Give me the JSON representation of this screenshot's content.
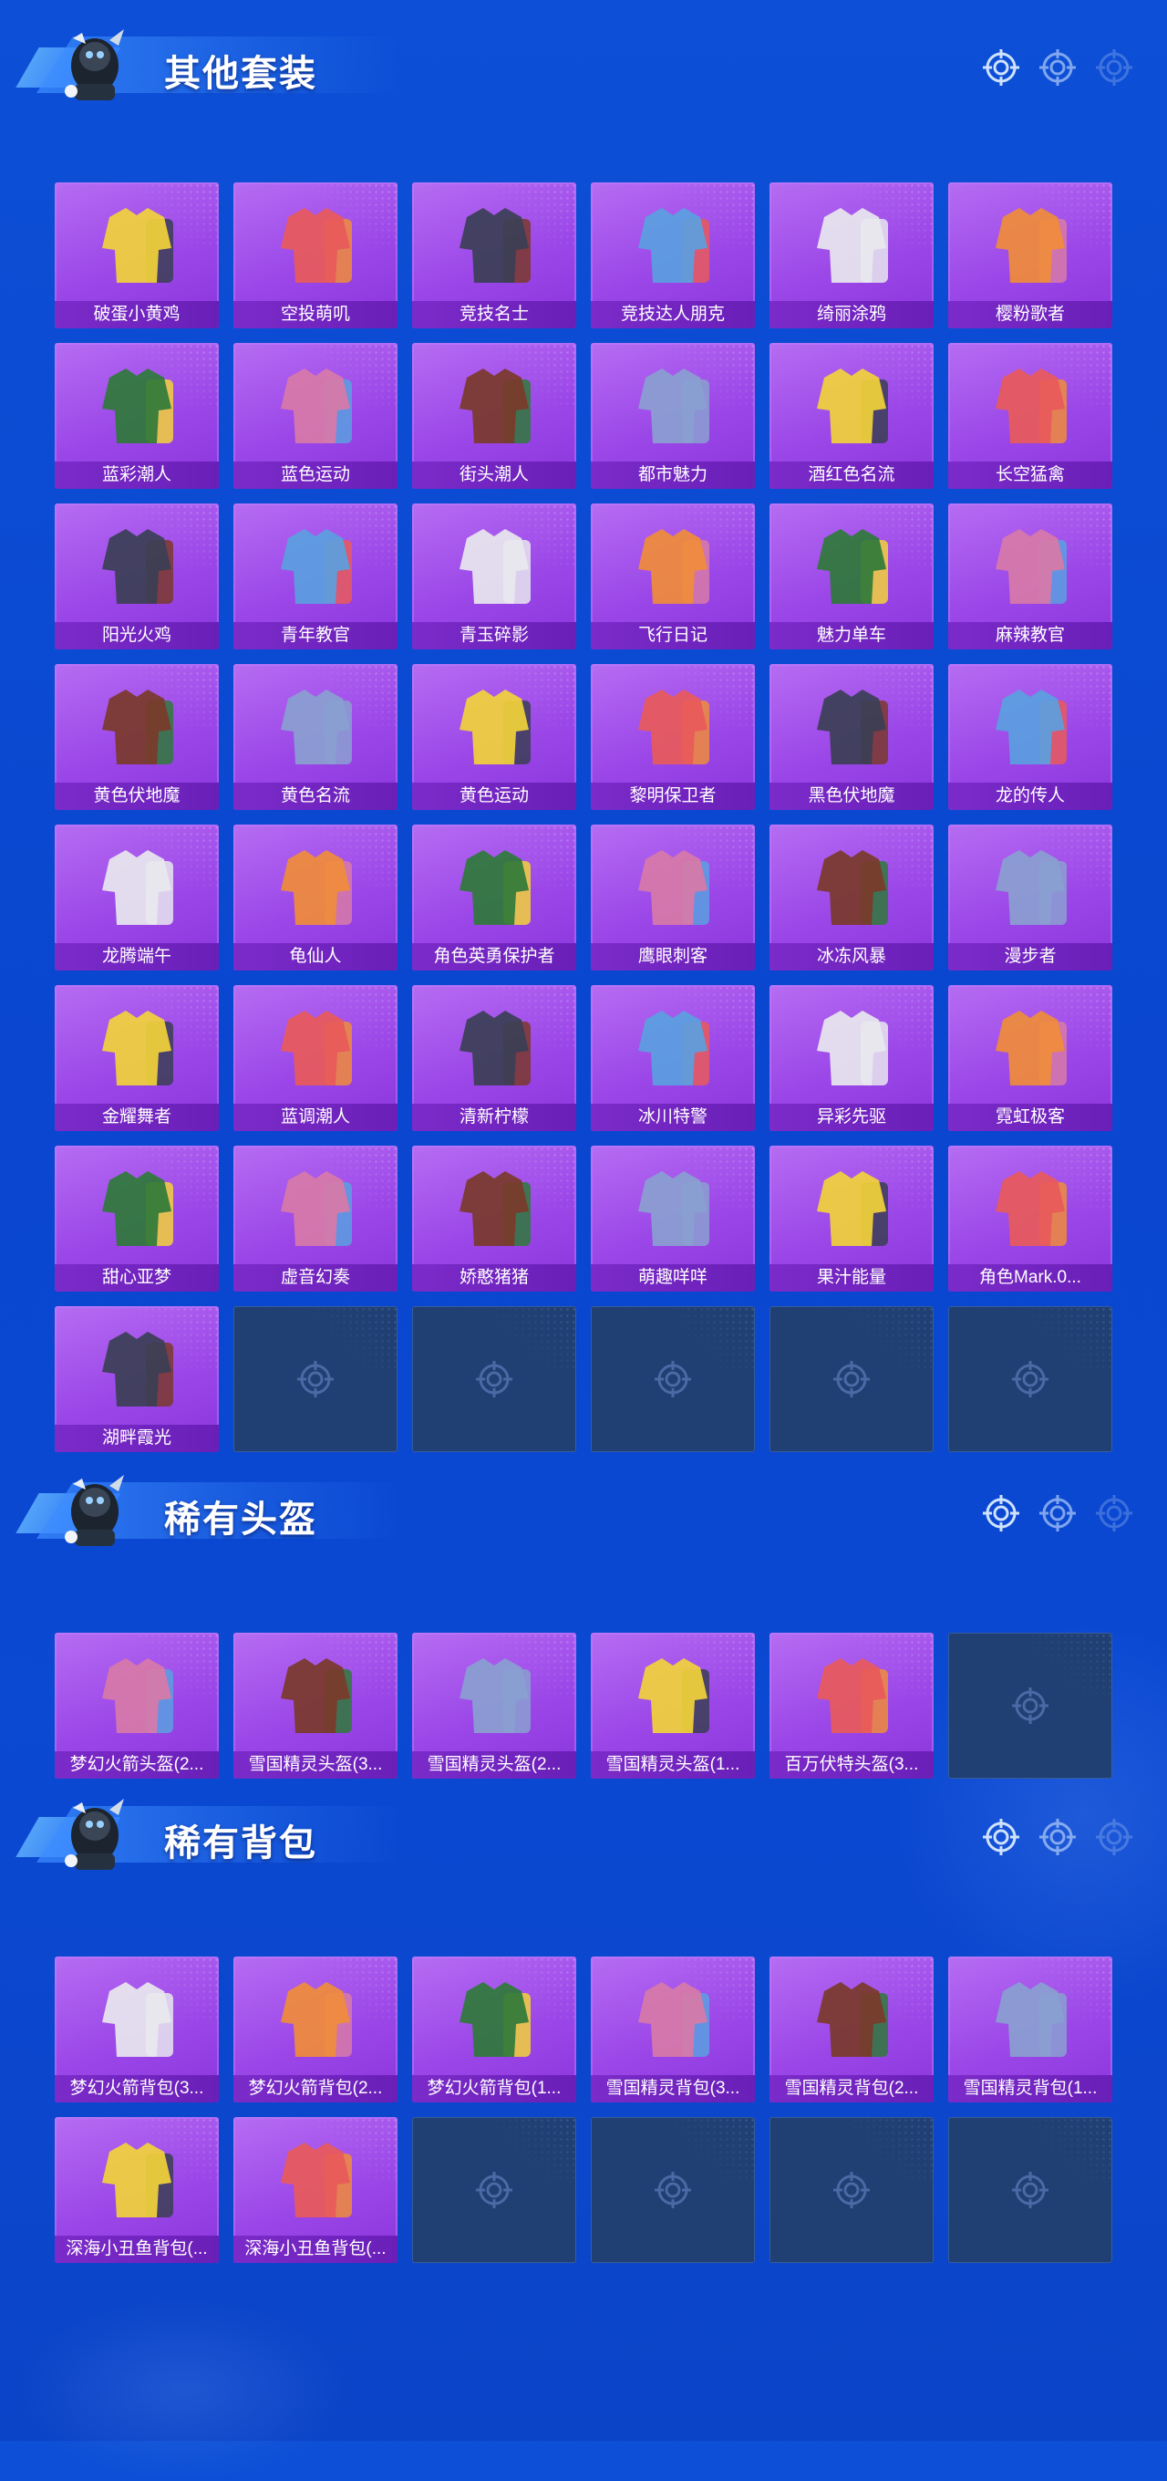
{
  "sections": [
    {
      "title": "其他套装",
      "items": [
        "破蛋小黄鸡",
        "空投萌叽",
        "竞技名士",
        "竞技达人朋克",
        "绮丽涂鸦",
        "樱粉歌者",
        "蓝彩潮人",
        "蓝色运动",
        "街头潮人",
        "都市魅力",
        "酒红色名流",
        "长空猛禽",
        "阳光火鸡",
        "青年教官",
        "青玉碎影",
        "飞行日记",
        "魅力单车",
        "麻辣教官",
        "黄色伏地魔",
        "黄色名流",
        "黄色运动",
        "黎明保卫者",
        "黑色伏地魔",
        "龙的传人",
        "龙腾端午",
        "龟仙人",
        "角色英勇保护者",
        "鹰眼刺客",
        "冰冻风暴",
        "漫步者",
        "金耀舞者",
        "蓝调潮人",
        "清新柠檬",
        "冰川特警",
        "异彩先驱",
        "霓虹极客",
        "甜心亚梦",
        "虚音幻奏",
        "娇憨猪猪",
        "萌趣咩咩",
        "果汁能量",
        "角色Mark.0...",
        "湖畔霞光"
      ],
      "empty_slots": 5
    },
    {
      "title": "稀有头盔",
      "items": [
        "梦幻火箭头盔(2...",
        "雪国精灵头盔(3...",
        "雪国精灵头盔(2...",
        "雪国精灵头盔(1...",
        "百万伏特头盔(3..."
      ],
      "empty_slots": 1
    },
    {
      "title": "稀有背包",
      "items": [
        "梦幻火箭背包(3...",
        "梦幻火箭背包(2...",
        "梦幻火箭背包(1...",
        "雪国精灵背包(3...",
        "雪国精灵背包(2...",
        "雪国精灵背包(1...",
        "深海小丑鱼背包(...",
        "深海小丑鱼背包(..."
      ],
      "empty_slots": 4
    }
  ],
  "colors": {
    "card": "#9b47e8",
    "label": "#7b2bc9",
    "empty": "#203f72",
    "background": "#0d4fd6"
  },
  "icons": {
    "section": "avatar-mascot",
    "reticle": "crosshair-icon"
  }
}
